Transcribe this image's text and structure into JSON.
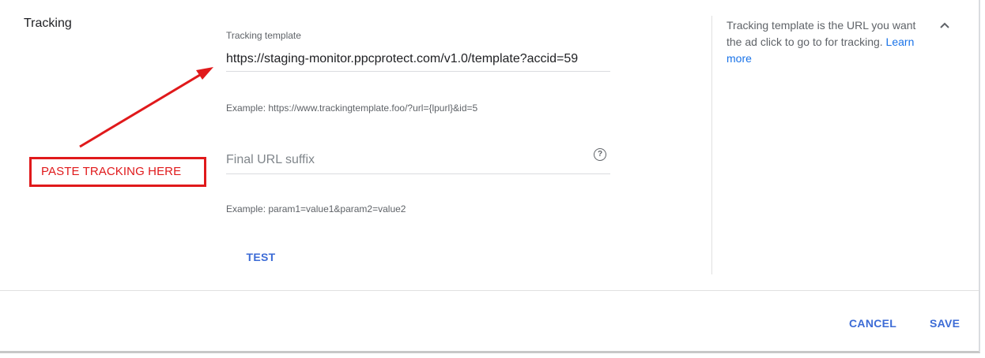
{
  "section": {
    "title": "Tracking"
  },
  "tracking_template": {
    "label": "Tracking template",
    "value": "https://staging-monitor.ppcprotect.com/v1.0/template?accid=59",
    "example": "Example: https://www.trackingtemplate.foo/?url={lpurl}&id=5"
  },
  "final_url_suffix": {
    "placeholder": "Final URL suffix",
    "help_icon": "help-circle-icon",
    "example": "Example: param1=value1&param2=value2"
  },
  "test_button": {
    "label": "TEST"
  },
  "side_help": {
    "text": "Tracking template is the URL you want the ad click to go to for tracking. ",
    "link": "Learn more",
    "collapse_icon": "chevron-up-icon"
  },
  "footer": {
    "cancel_label": "CANCEL",
    "save_label": "SAVE"
  },
  "annotation": {
    "text": "PASTE TRACKING HERE",
    "color": "#e0191b"
  },
  "colors": {
    "accent": "#3c6bd6",
    "link": "#1a73e8",
    "annotation": "#e0191b"
  }
}
